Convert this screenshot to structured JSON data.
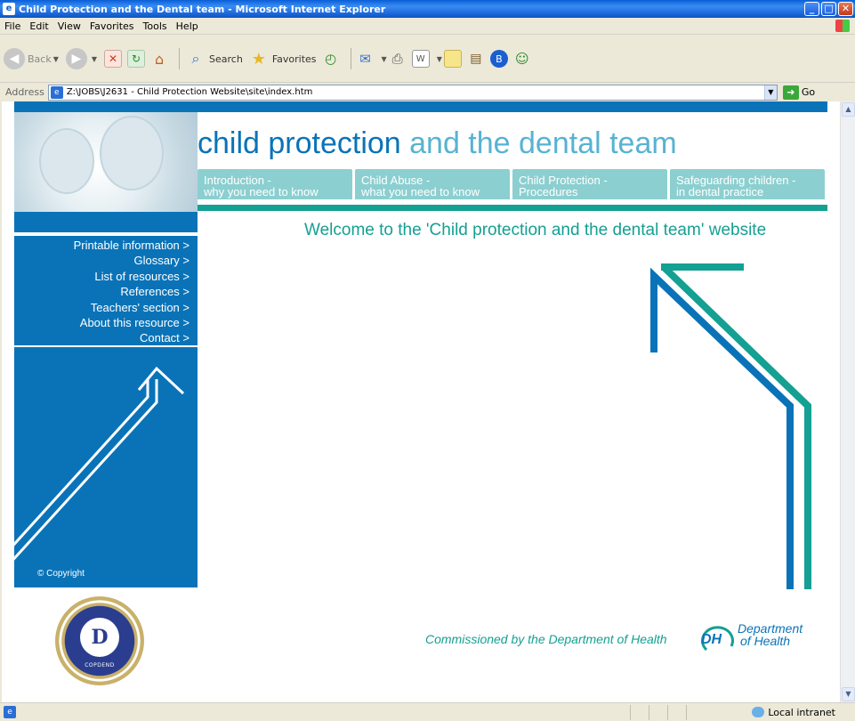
{
  "window": {
    "title": "Child Protection and the Dental team - Microsoft Internet Explorer"
  },
  "menu": [
    "File",
    "Edit",
    "View",
    "Favorites",
    "Tools",
    "Help"
  ],
  "toolbar": {
    "back_label": "Back",
    "search_label": "Search",
    "favorites_label": "Favorites"
  },
  "address": {
    "label": "Address",
    "url": "Z:\\JOBS\\J2631 - Child Protection Website\\site\\index.htm",
    "go_label": "Go"
  },
  "site": {
    "title_dark": "child protection",
    "title_light": " and the dental team",
    "tabs": [
      {
        "line1": "Introduction -",
        "line2": "why you need to know"
      },
      {
        "line1": "Child Abuse -",
        "line2": "what you need to know"
      },
      {
        "line1": "Child Protection -",
        "line2": "Procedures"
      },
      {
        "line1": "Safeguarding children -",
        "line2": "in dental practice"
      }
    ],
    "sidebar_links": [
      "Printable information >",
      "Glossary >",
      "List of resources >",
      "References >",
      "Teachers' section >",
      "About this resource >",
      "Contact >"
    ],
    "copyright": "© Copyright",
    "welcome": "Welcome to the 'Child protection and the dental team' website",
    "commissioned": "Commissioned by the Department of Health",
    "dh_logo_text": "DH",
    "dh_name_line1": "Department",
    "dh_name_line2": "of Health",
    "seal_initials": "D",
    "seal_sub": "COPDEND"
  },
  "status": {
    "zone": "Local intranet"
  },
  "colors": {
    "site_blue": "#0a73b8",
    "site_teal": "#14a092",
    "tab_bg": "#8ccfd0",
    "title_light": "#57b3d2"
  }
}
